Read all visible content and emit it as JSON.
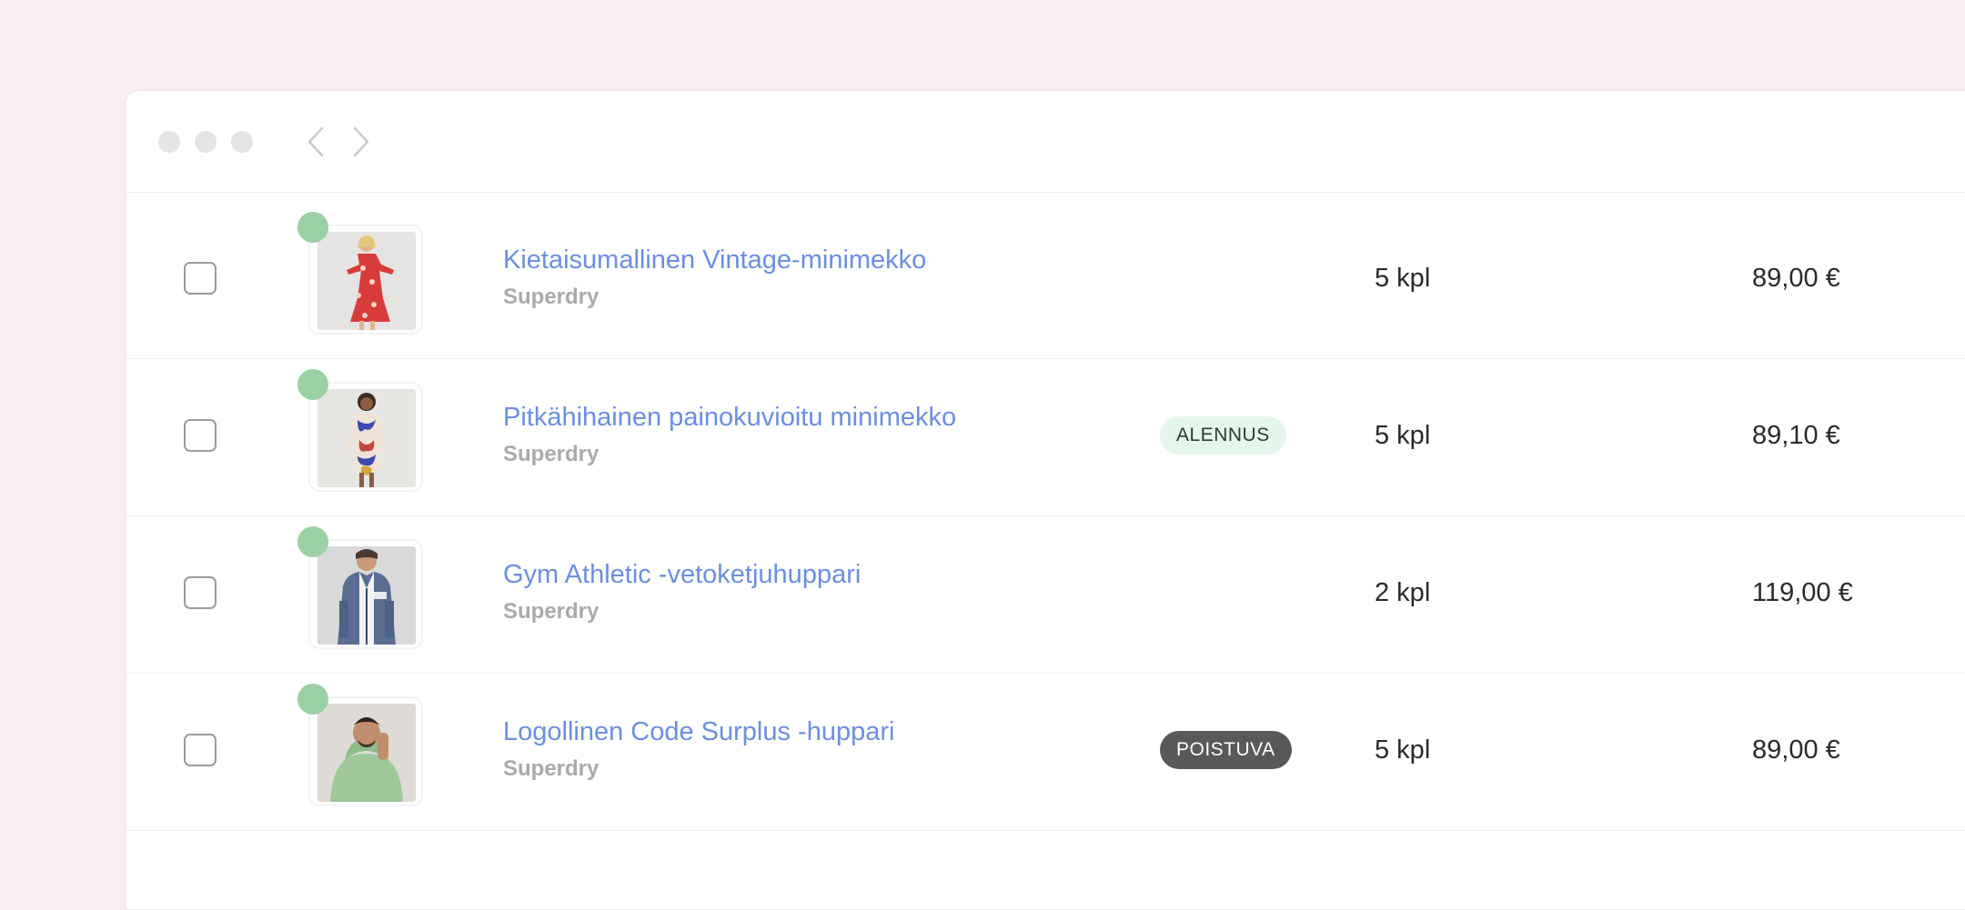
{
  "window": {
    "nav": {
      "back_icon": "chevron-left-icon",
      "forward_icon": "chevron-right-icon"
    }
  },
  "colors": {
    "background": "#fbeef4",
    "link": "#6b8ee0",
    "status_dot": "#9bd0a3",
    "sale_badge_bg": "#e4f6ec",
    "leaving_badge_bg": "#595959"
  },
  "products": [
    {
      "name": "Kietaisumallinen Vintage-minimekko",
      "brand": "Superdry",
      "badge": "",
      "quantity": "5 kpl",
      "price": "89,00 €",
      "image": "red-floral-dress"
    },
    {
      "name": "Pitkähihainen painokuvioitu minimekko",
      "brand": "Superdry",
      "badge": "ALENNUS",
      "quantity": "5 kpl",
      "price": "89,10 €",
      "image": "patterned-dress"
    },
    {
      "name": "Gym Athletic -vetoketjuhuppari",
      "brand": "Superdry",
      "badge": "",
      "quantity": "2 kpl",
      "price": "119,00 €",
      "image": "blue-zip-hoodie"
    },
    {
      "name": "Logollinen Code Surplus -huppari",
      "brand": "Superdry",
      "badge": "POISTUVA",
      "quantity": "5 kpl",
      "price": "89,00 €",
      "image": "green-hoodie"
    }
  ]
}
